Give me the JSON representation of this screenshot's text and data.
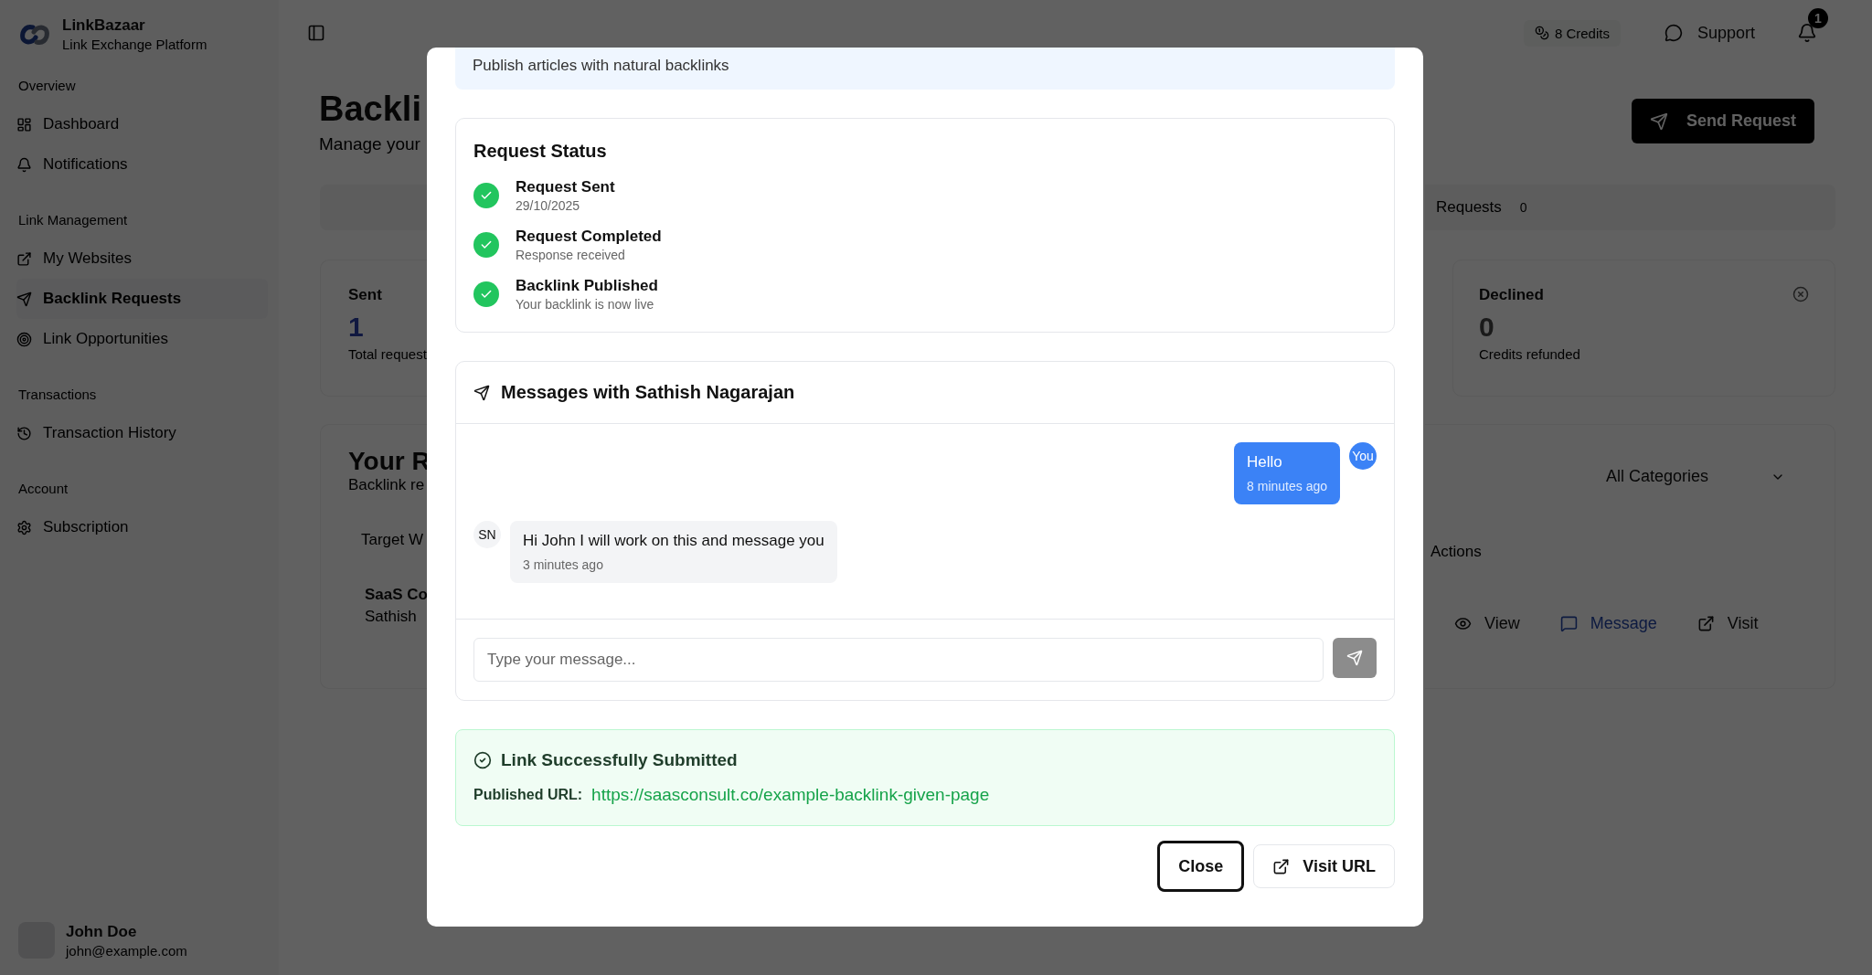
{
  "brand": {
    "name": "LinkBazaar",
    "tagline": "Link Exchange Platform"
  },
  "sidebar": {
    "sections": [
      {
        "label": "Overview",
        "items": [
          {
            "label": "Dashboard",
            "selected": false
          },
          {
            "label": "Notifications",
            "selected": false
          }
        ]
      },
      {
        "label": "Link Management",
        "items": [
          {
            "label": "My Websites",
            "selected": false
          },
          {
            "label": "Backlink Requests",
            "selected": true
          },
          {
            "label": "Link Opportunities",
            "selected": false
          }
        ]
      },
      {
        "label": "Transactions",
        "items": [
          {
            "label": "Transaction History",
            "selected": false
          }
        ]
      },
      {
        "label": "Account",
        "items": [
          {
            "label": "Subscription",
            "selected": false
          }
        ]
      }
    ]
  },
  "user": {
    "name": "John Doe",
    "email": "john@example.com"
  },
  "header": {
    "credits": "8 Credits",
    "support": "Support",
    "notification_count": "1"
  },
  "page": {
    "title": "Backli",
    "subtitle": "Manage your",
    "send_button": "Send Request",
    "tab": {
      "label": "Requests",
      "count": "0"
    },
    "stats": [
      {
        "label": "Sent",
        "value": "1",
        "caption": "Total request"
      },
      {
        "label": "Declined",
        "value": "0",
        "caption": "Credits refunded"
      }
    ],
    "requests": {
      "title": "Your R",
      "subtitle": "Backlink re",
      "category_filter": "All Categories",
      "columns": [
        "Target W",
        "Actions"
      ],
      "row": {
        "site": "SaaS Co",
        "owner": "Sathish",
        "actions": [
          {
            "label": "View",
            "primary": false
          },
          {
            "label": "Message",
            "primary": true
          },
          {
            "label": "Visit",
            "primary": false
          }
        ]
      }
    }
  },
  "dialog": {
    "description": "Publish articles with natural backlinks",
    "status": {
      "title": "Request Status",
      "steps": [
        {
          "title": "Request Sent",
          "detail": "29/10/2025",
          "done": true
        },
        {
          "title": "Request Completed",
          "detail": "Response received",
          "done": true
        },
        {
          "title": "Backlink Published",
          "detail": "Your backlink is now live",
          "done": true
        }
      ]
    },
    "messages": {
      "title": "Messages with Sathish Nagarajan",
      "items": [
        {
          "kind": "sent",
          "avatar": "You",
          "text": "Hello",
          "time": "8 minutes ago"
        },
        {
          "kind": "received",
          "avatar": "SN",
          "text": "Hi John I will work on this and message you",
          "time": "3 minutes ago"
        }
      ],
      "placeholder": "Type your message..."
    },
    "success": {
      "title": "Link Successfully Submitted",
      "label": "Published URL:",
      "url": "https://saasconsult.co/example-backlink-given-page"
    },
    "buttons": [
      {
        "label": "Close",
        "focused": true
      },
      {
        "label": "Visit URL",
        "focused": false
      }
    ]
  }
}
